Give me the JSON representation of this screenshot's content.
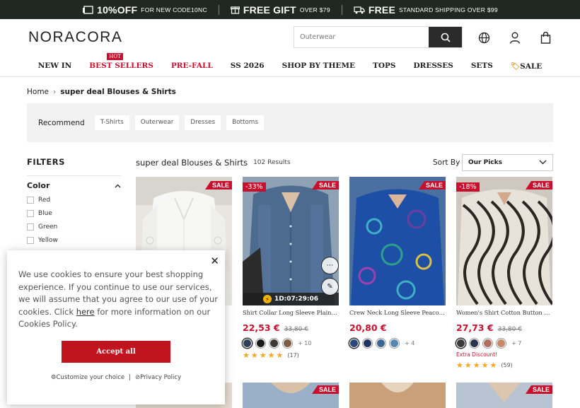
{
  "topbar": {
    "promo1_big": "10%OFF",
    "promo1_small": "FOR NEW   CODE10NC",
    "promo2_big": "FREE GIFT",
    "promo2_small": "OVER $79",
    "promo3_big": "FREE",
    "promo3_small": "STANDARD SHIPPING OVER $99"
  },
  "header": {
    "logo": "NORACORA",
    "search_placeholder": "Outerwear"
  },
  "nav": {
    "items": [
      "NEW IN",
      "BEST SELLERS",
      "PRE-FALL",
      "SS 2026",
      "SHOP BY THEME",
      "TOPS",
      "DRESSES",
      "SETS",
      "SALE"
    ],
    "hot_badge": "HOT"
  },
  "breadcrumb": {
    "home": "Home",
    "separator": "›",
    "current": "super deal Blouses & Shirts"
  },
  "recommend": {
    "label": "Recommend",
    "chips": [
      "T-Shirts",
      "Outerwear",
      "Dresses",
      "Bottoms"
    ]
  },
  "filters": {
    "title": "FILTERS",
    "section": "Color",
    "options": [
      "Red",
      "Blue",
      "Green",
      "Yellow"
    ]
  },
  "results": {
    "title": "super deal Blouses & Shirts",
    "count": "102 Results",
    "sort_label": "Sort By",
    "sort_value": "Our Picks"
  },
  "products": [
    {
      "sale": "SALE",
      "discount": "",
      "name": "",
      "price": "",
      "old_price": ""
    },
    {
      "sale": "SALE",
      "discount": "-33%",
      "timer": "1D:07:29:06",
      "name": "Shirt Collar Long Sleeve Plain Regular Blouse",
      "price": "22,53 €",
      "old_price": "33,80 €",
      "swatch_colors": [
        "#2e3f5c",
        "#1a1a1a",
        "#3d3a35",
        "#7a5e44"
      ],
      "more": "+ 10",
      "reviews": "(17)"
    },
    {
      "sale": "SALE",
      "discount": "",
      "name": "Crew Neck Long Sleeve Peacock Feather Print Blouse",
      "price": "20,80 €",
      "old_price": "",
      "swatch_colors": [
        "#2b4a7a",
        "#1e3560",
        "#3c6690",
        "#5a86b0"
      ],
      "more": "+ 4"
    },
    {
      "sale": "SALE",
      "discount": "-18%",
      "name": "Women's Shirt Cotton Button Up Long Sleeve Blouse",
      "price": "27,73 €",
      "old_price": "33,80 €",
      "swatch_colors": [
        "#3a3a3a",
        "#2b3550",
        "#b07060",
        "#c48a6a"
      ],
      "more": "+ 7",
      "extra": "Extra Discount!",
      "reviews": "(59)"
    }
  ],
  "cookie": {
    "text_before": "We use cookies to ensure your best shopping experience. If you continue to use our services, we will assume that you agree to our use of your cookies. Click ",
    "link": "here",
    "text_after": " for more information on our Cookies Policy.",
    "accept": "Accept all",
    "customize": "Customize your choice",
    "divider": "|",
    "privacy": "Privacy Policy"
  },
  "colors": {
    "brand_red": "#c8102e",
    "topbar_bg": "#1f2922",
    "star": "#f5a623"
  }
}
